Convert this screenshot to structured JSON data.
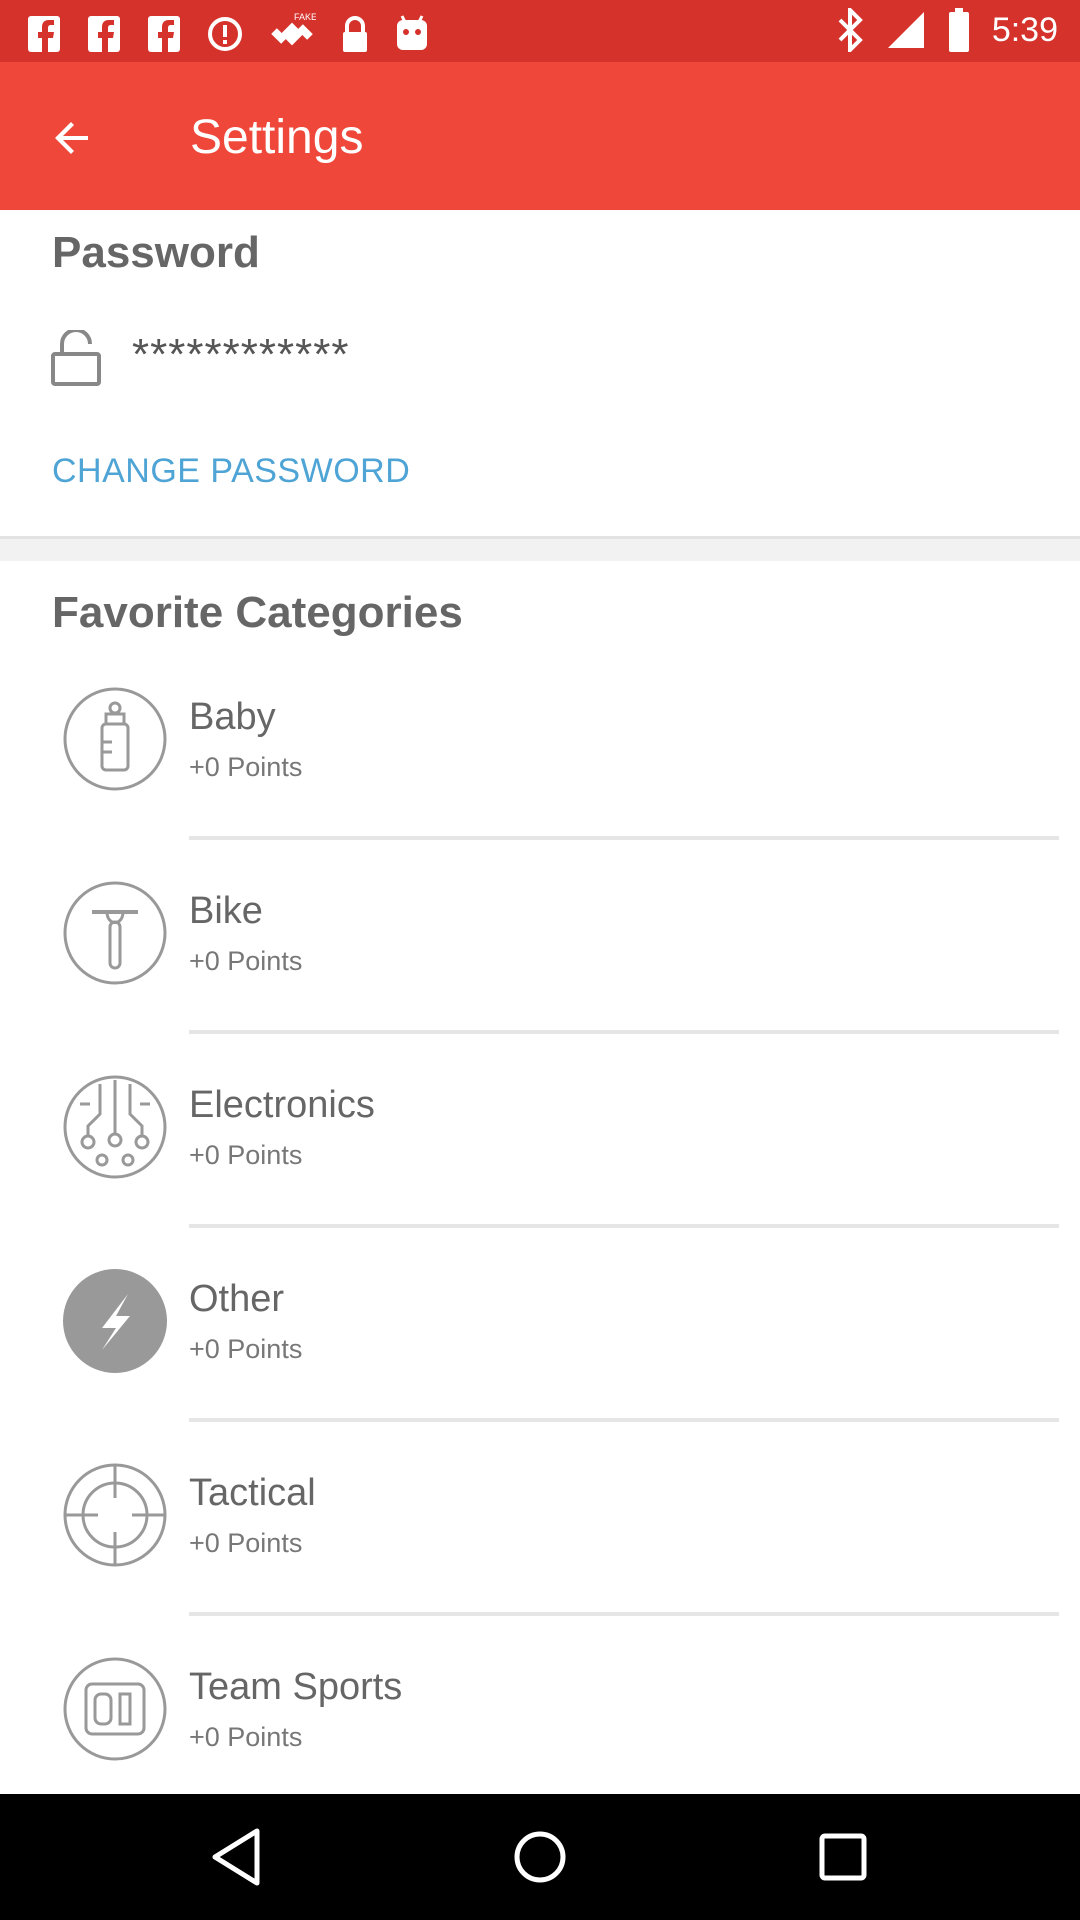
{
  "status_bar": {
    "time": "5:39",
    "left_icons": [
      "facebook-icon",
      "facebook-icon",
      "facebook-icon",
      "alert-icon",
      "fake-gps-icon",
      "lock-icon",
      "android-icon"
    ],
    "right_icons": [
      "bluetooth-icon",
      "signal-icon",
      "battery-icon"
    ],
    "bg_color": "#d6322c"
  },
  "app_bar": {
    "title": "Settings",
    "bg_color": "#ef473a"
  },
  "password_section": {
    "title": "Password",
    "value": "************",
    "change_label": "CHANGE PASSWORD",
    "link_color": "#4fa4d6"
  },
  "categories_section": {
    "title": "Favorite Categories",
    "items": [
      {
        "name": "Baby",
        "points": "+0 Points",
        "icon": "baby-bottle-icon"
      },
      {
        "name": "Bike",
        "points": "+0 Points",
        "icon": "bike-icon"
      },
      {
        "name": "Electronics",
        "points": "+0 Points",
        "icon": "circuit-icon"
      },
      {
        "name": "Other",
        "points": "+0 Points",
        "icon": "lightning-icon"
      },
      {
        "name": "Tactical",
        "points": "+0 Points",
        "icon": "crosshair-icon"
      },
      {
        "name": "Team Sports",
        "points": "+0 Points",
        "icon": "jersey-number-icon"
      }
    ]
  },
  "nav_bar": {
    "buttons": [
      "back-nav-icon",
      "home-nav-icon",
      "recents-nav-icon"
    ]
  }
}
